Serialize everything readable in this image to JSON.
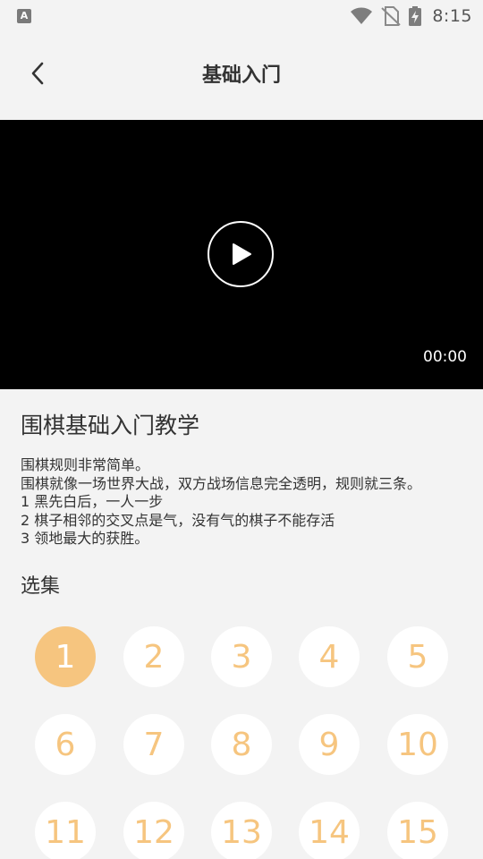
{
  "status_bar": {
    "app_badge": "A",
    "time": "8:15",
    "icons": [
      "wifi-icon",
      "no-sim-icon",
      "battery-charging-icon"
    ]
  },
  "header": {
    "back_icon": "chevron-left-icon",
    "title": "基础入门"
  },
  "video": {
    "play_icon": "play-icon",
    "time": "00:00"
  },
  "lesson": {
    "title": "围棋基础入门教学",
    "description": [
      "围棋规则非常简单。",
      "围棋就像一场世界大战，双方战场信息完全透明，规则就三条。",
      "1 黑先白后，一人一步",
      "2 棋子相邻的交叉点是气，没有气的棋子不能存活",
      "3 领地最大的获胜。"
    ]
  },
  "episodes": {
    "heading": "选集",
    "selected": "1",
    "items": [
      "1",
      "2",
      "3",
      "4",
      "5",
      "6",
      "7",
      "8",
      "9",
      "10",
      "11",
      "12",
      "13",
      "14",
      "15"
    ]
  },
  "colors": {
    "accent": "#f6c57f",
    "background": "#f3f3f3",
    "video_bg": "#000000"
  }
}
